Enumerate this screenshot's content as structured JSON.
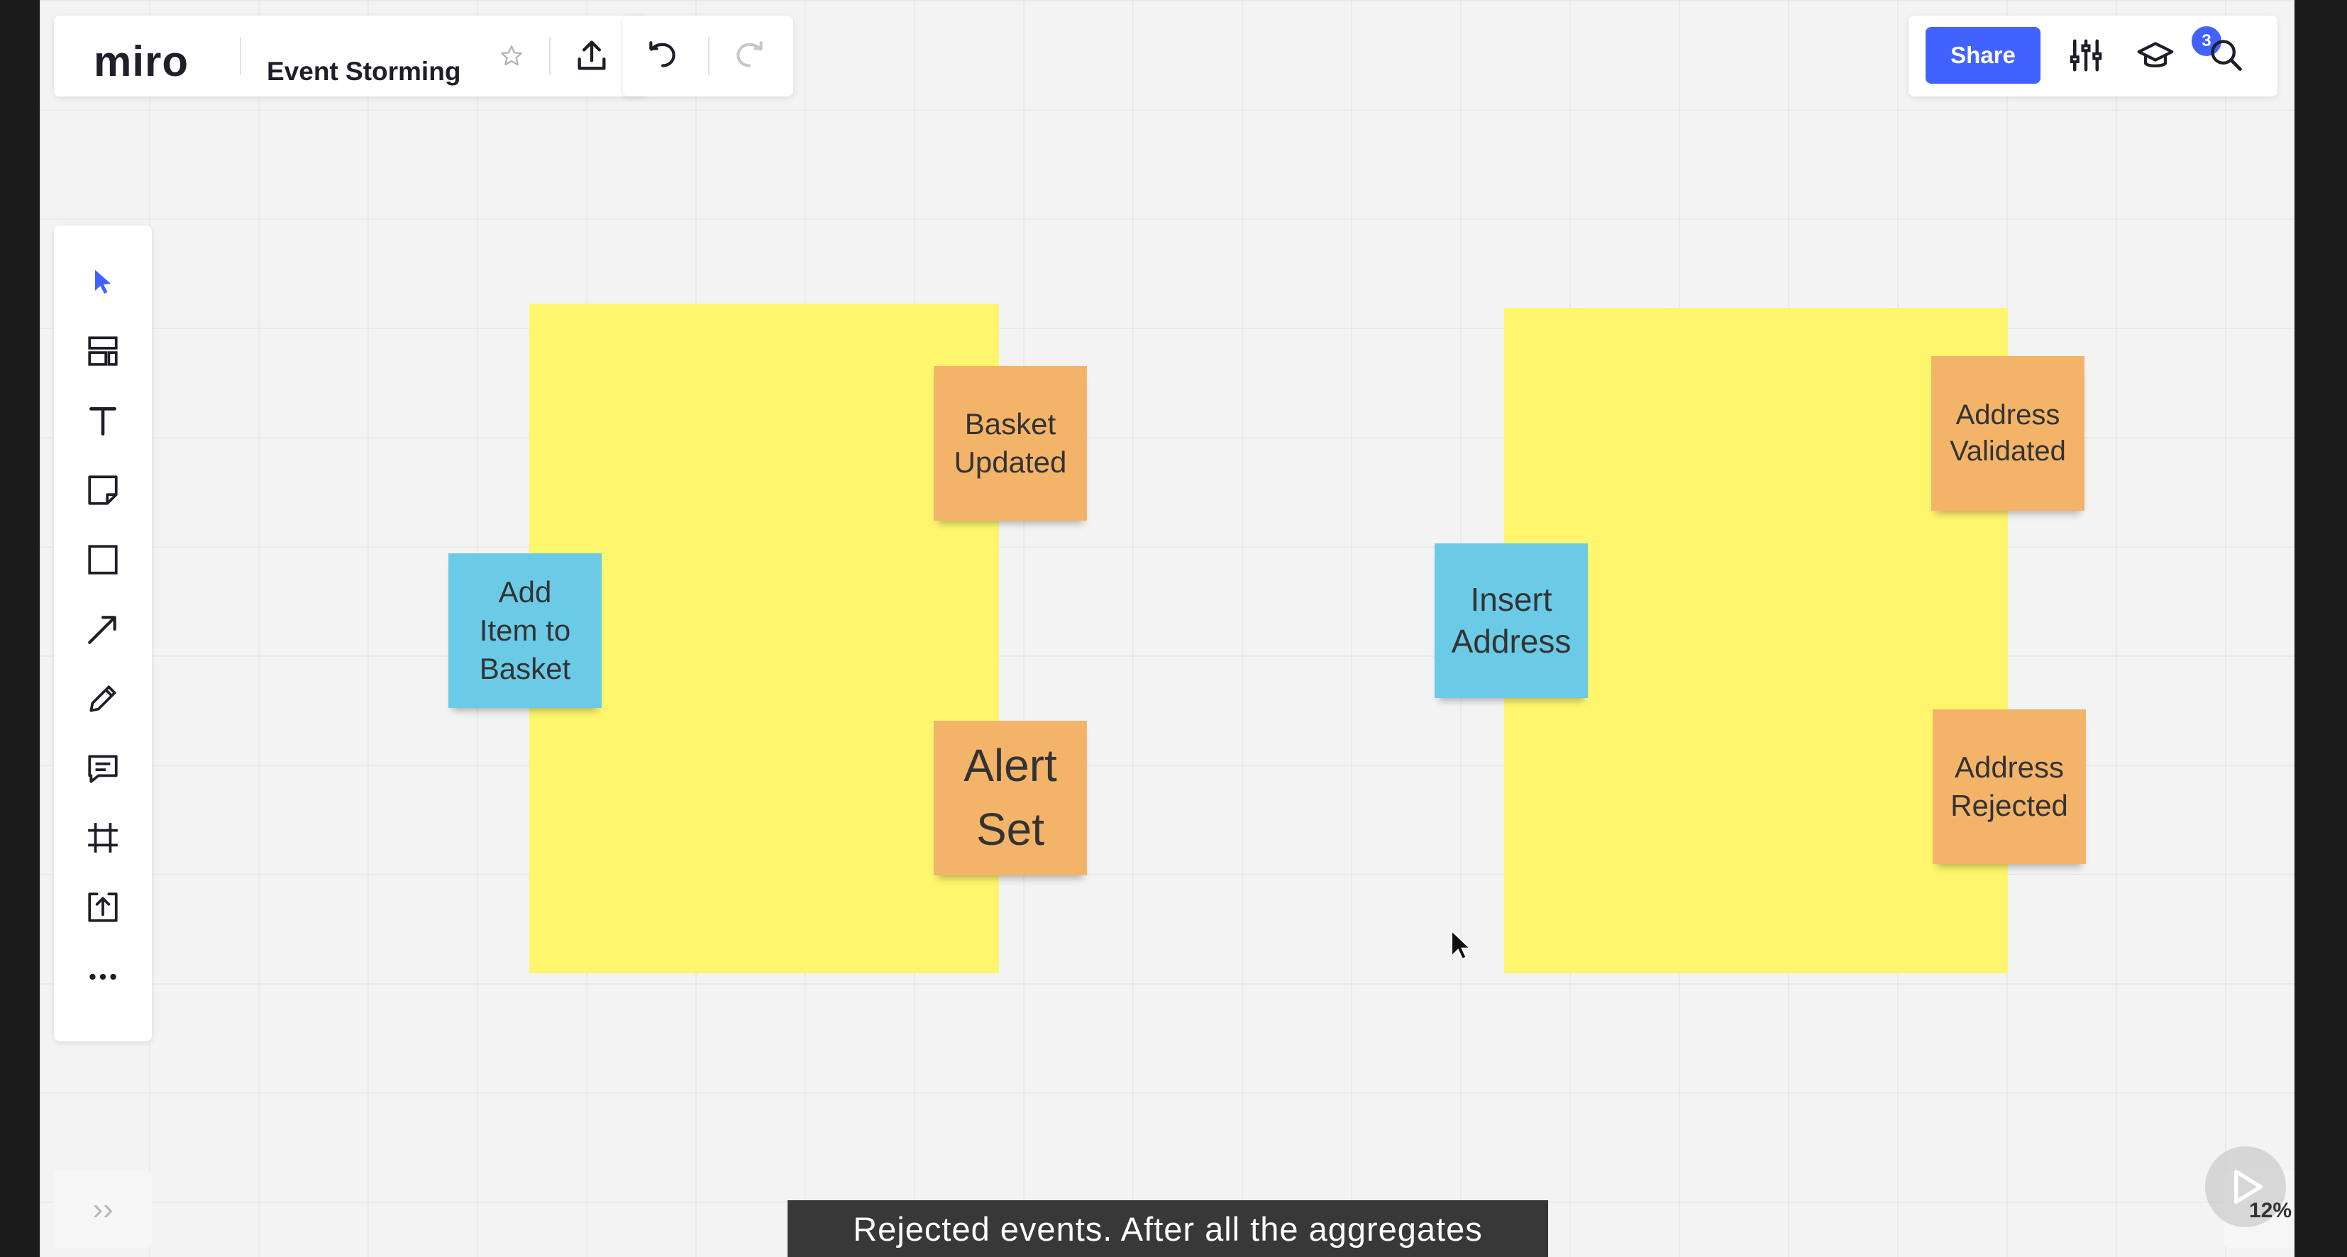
{
  "header": {
    "logo": "miro",
    "board_name": "Event Storming",
    "share_label": "Share",
    "notification_count": "3"
  },
  "toolbar": {
    "tools": [
      "select-icon",
      "templates-icon",
      "text-icon",
      "sticky-note-icon",
      "shape-icon",
      "arrow-line-icon",
      "pen-icon",
      "comment-icon",
      "frame-icon",
      "upload-icon",
      "more-icon"
    ],
    "expand_label": "››"
  },
  "canvas": {
    "stickies": {
      "add_item": "Add\nItem to\nBasket",
      "basket_updated": "Basket\nUpdated",
      "alert_set": "Alert\nSet",
      "insert_address": "Insert\nAddress",
      "address_validated": "Address\nValidated",
      "address_rejected": "Address\nRejected"
    }
  },
  "footer": {
    "caption": "Rejected events. After all the aggregates",
    "zoom": "12%"
  },
  "colors": {
    "accent": "#4262ff",
    "frame_yellow": "#fff66e",
    "command_blue": "#6bcbe6",
    "event_orange": "#f3b469"
  }
}
